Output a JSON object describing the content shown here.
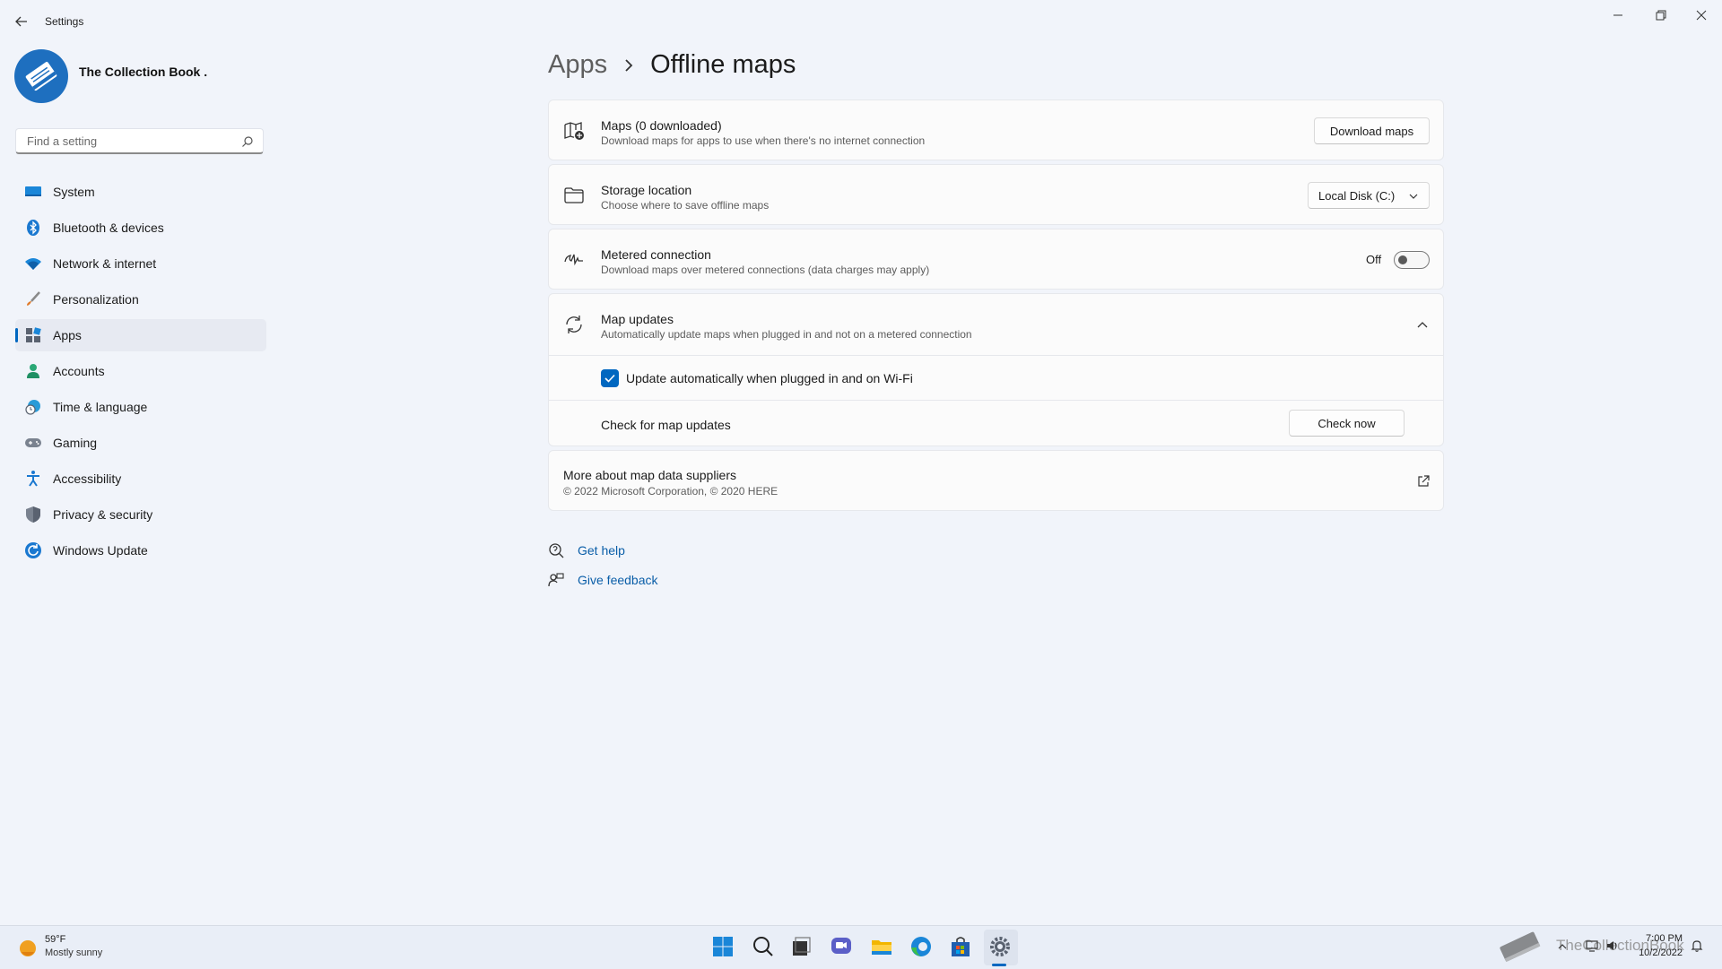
{
  "window": {
    "title": "Settings"
  },
  "profile": {
    "name": "The Collection Book ."
  },
  "search": {
    "placeholder": "Find a setting"
  },
  "nav": {
    "items": [
      {
        "label": "System",
        "icon": "monitor-icon"
      },
      {
        "label": "Bluetooth & devices",
        "icon": "bluetooth-icon"
      },
      {
        "label": "Network & internet",
        "icon": "wifi-icon"
      },
      {
        "label": "Personalization",
        "icon": "brush-icon"
      },
      {
        "label": "Apps",
        "icon": "apps-icon",
        "active": true
      },
      {
        "label": "Accounts",
        "icon": "person-icon"
      },
      {
        "label": "Time & language",
        "icon": "clock-globe-icon"
      },
      {
        "label": "Gaming",
        "icon": "gamepad-icon"
      },
      {
        "label": "Accessibility",
        "icon": "accessibility-icon"
      },
      {
        "label": "Privacy & security",
        "icon": "shield-icon"
      },
      {
        "label": "Windows Update",
        "icon": "update-icon"
      }
    ]
  },
  "breadcrumb": {
    "parent": "Apps",
    "current": "Offline maps"
  },
  "maps": {
    "title": "Maps (0 downloaded)",
    "desc": "Download maps for apps to use when there's no internet connection",
    "button": "Download maps"
  },
  "storage": {
    "title": "Storage location",
    "desc": "Choose where to save offline maps",
    "selected": "Local Disk (C:)"
  },
  "metered": {
    "title": "Metered connection",
    "desc": "Download maps over metered connections (data charges may apply)",
    "state_label": "Off",
    "on": false
  },
  "map_updates": {
    "title": "Map updates",
    "desc": "Automatically update maps when plugged in and not on a metered connection",
    "checkbox_label": "Update automatically when plugged in and on Wi-Fi",
    "checked": true,
    "check_label": "Check for map updates",
    "check_button": "Check now"
  },
  "suppliers": {
    "title": "More about map data suppliers",
    "desc": "© 2022 Microsoft Corporation, © 2020 HERE"
  },
  "help_links": {
    "get_help": "Get help",
    "give_feedback": "Give feedback"
  },
  "taskbar": {
    "weather_temp": "59°F",
    "weather_desc": "Mostly sunny",
    "time": "7:00 PM",
    "date": "10/2/2022",
    "watermark": "TheCollectionBook"
  },
  "colors": {
    "accent": "#0067c0",
    "background": "#f1f4fa",
    "card": "#fbfbfb"
  }
}
